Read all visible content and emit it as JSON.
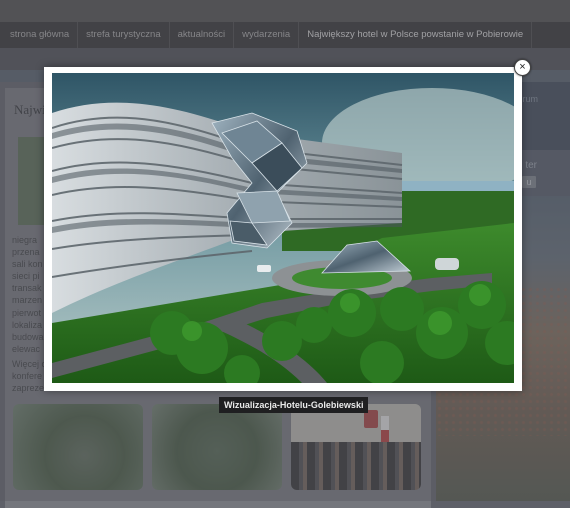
{
  "nav": {
    "items": [
      {
        "label": "strona główna"
      },
      {
        "label": "strefa turystyczna"
      },
      {
        "label": "aktualności"
      },
      {
        "label": "wydarzenia"
      },
      {
        "label": "Największy hotel w Polsce powstanie w Pobierowie"
      }
    ]
  },
  "article": {
    "title": "Najwi",
    "lines_1": [
      "niegra",
      "przena",
      "sali kon",
      "sieci pi",
      "transak",
      "marzen",
      "pierwot",
      "lokaliza",
      "budowa",
      "elewac"
    ],
    "lines_2": [
      "Więcej o",
      "konfere",
      "zaprezen"
    ]
  },
  "sidebar": {
    "top_text": "rum",
    "mid_label": "ter",
    "mid_button": "u"
  },
  "lightbox": {
    "caption": "Wizualizacja-Hotelu-Golebiewski",
    "close_glyph": "×"
  },
  "colors": {
    "overlay": "rgba(90,90,98,0.45)",
    "nav_bg": "#2f2f31",
    "caption_bg": "#1f1f21"
  }
}
